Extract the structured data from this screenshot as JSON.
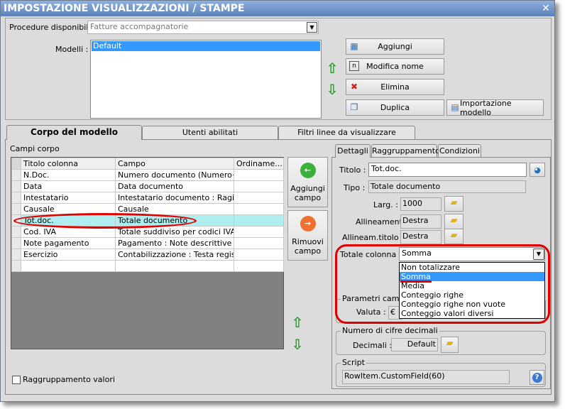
{
  "window": {
    "title": "IMPOSTAZIONE VISUALIZZAZIONI / STAMPE"
  },
  "top": {
    "procedure_label": "Procedure disponibili :",
    "procedure_value": "Fatture accompagnatorie",
    "modelli_label": "Modelli :",
    "modelli": [
      "Default"
    ],
    "buttons": {
      "aggiungi": "Aggiungi",
      "modifica": "Modifica nome",
      "elimina": "Elimina",
      "duplica": "Duplica",
      "importazione": "Importazione modello"
    }
  },
  "tabs": [
    "Corpo del modello",
    "Utenti abilitati",
    "Filtri linee da visualizzare"
  ],
  "corpo": {
    "campi_label": "Campi corpo",
    "columns": [
      "Titolo colonna",
      "Campo",
      "Ordiname..."
    ],
    "rows": [
      [
        "N.Doc.",
        "Numero documento (Numero+..."
      ],
      [
        "Data",
        "Data documento"
      ],
      [
        "Intestatario",
        "Intestatario documento : Ragi..."
      ],
      [
        "Causale",
        "Causale"
      ],
      [
        "Tot.doc.",
        "Totale documento"
      ],
      [
        "Cod. IVA",
        "Totale suddiviso per codici IVA ..."
      ],
      [
        "Note pagamento",
        "Pagamento : Note descrittive i..."
      ],
      [
        "Esercizio",
        "Contabilizzazione : Testa regist..."
      ]
    ],
    "selected_row": 4,
    "aggiungi_campo": "Aggiungi campo",
    "rimuovi_campo": "Rimuovi campo",
    "raggruppamento_valori": "Raggruppamento valori",
    "raggruppamento_checked": false
  },
  "details": {
    "subtabs": [
      "Dettagli",
      "Raggruppamento",
      "Condizioni"
    ],
    "titolo_label": "Titolo :",
    "titolo": "Tot.doc.",
    "tipo_label": "Tipo :",
    "tipo": "Totale documento",
    "larg_label": "Larg. :",
    "larg": "1000",
    "allineamento_label": "Allineamento :",
    "allineamento": "Destra",
    "allineam_titolo_label": "Allineam.titolo :",
    "allineam_titolo": "Destra",
    "totale_label": "Totale colonna :",
    "totale": "Somma",
    "totale_options": [
      "Non totalizzare",
      "Somma",
      "Media",
      "Conteggio righe",
      "Conteggio righe non vuote",
      "Conteggio valori diversi"
    ],
    "totale_selected": 1,
    "parametri_label": "Parametri campo",
    "valuta_label": "Valuta :",
    "valuta": "€",
    "decimali_group": "Numero di cifre decimali",
    "decimali_label": "Decimali :",
    "decimali": "Default",
    "script_group": "Script",
    "script": "RowItem.CustomField(60)"
  },
  "colors": {
    "title": "#5b82bb",
    "selection": "#3399ff",
    "row_highlight": "#aeeeee",
    "annotation": "#e00000"
  }
}
